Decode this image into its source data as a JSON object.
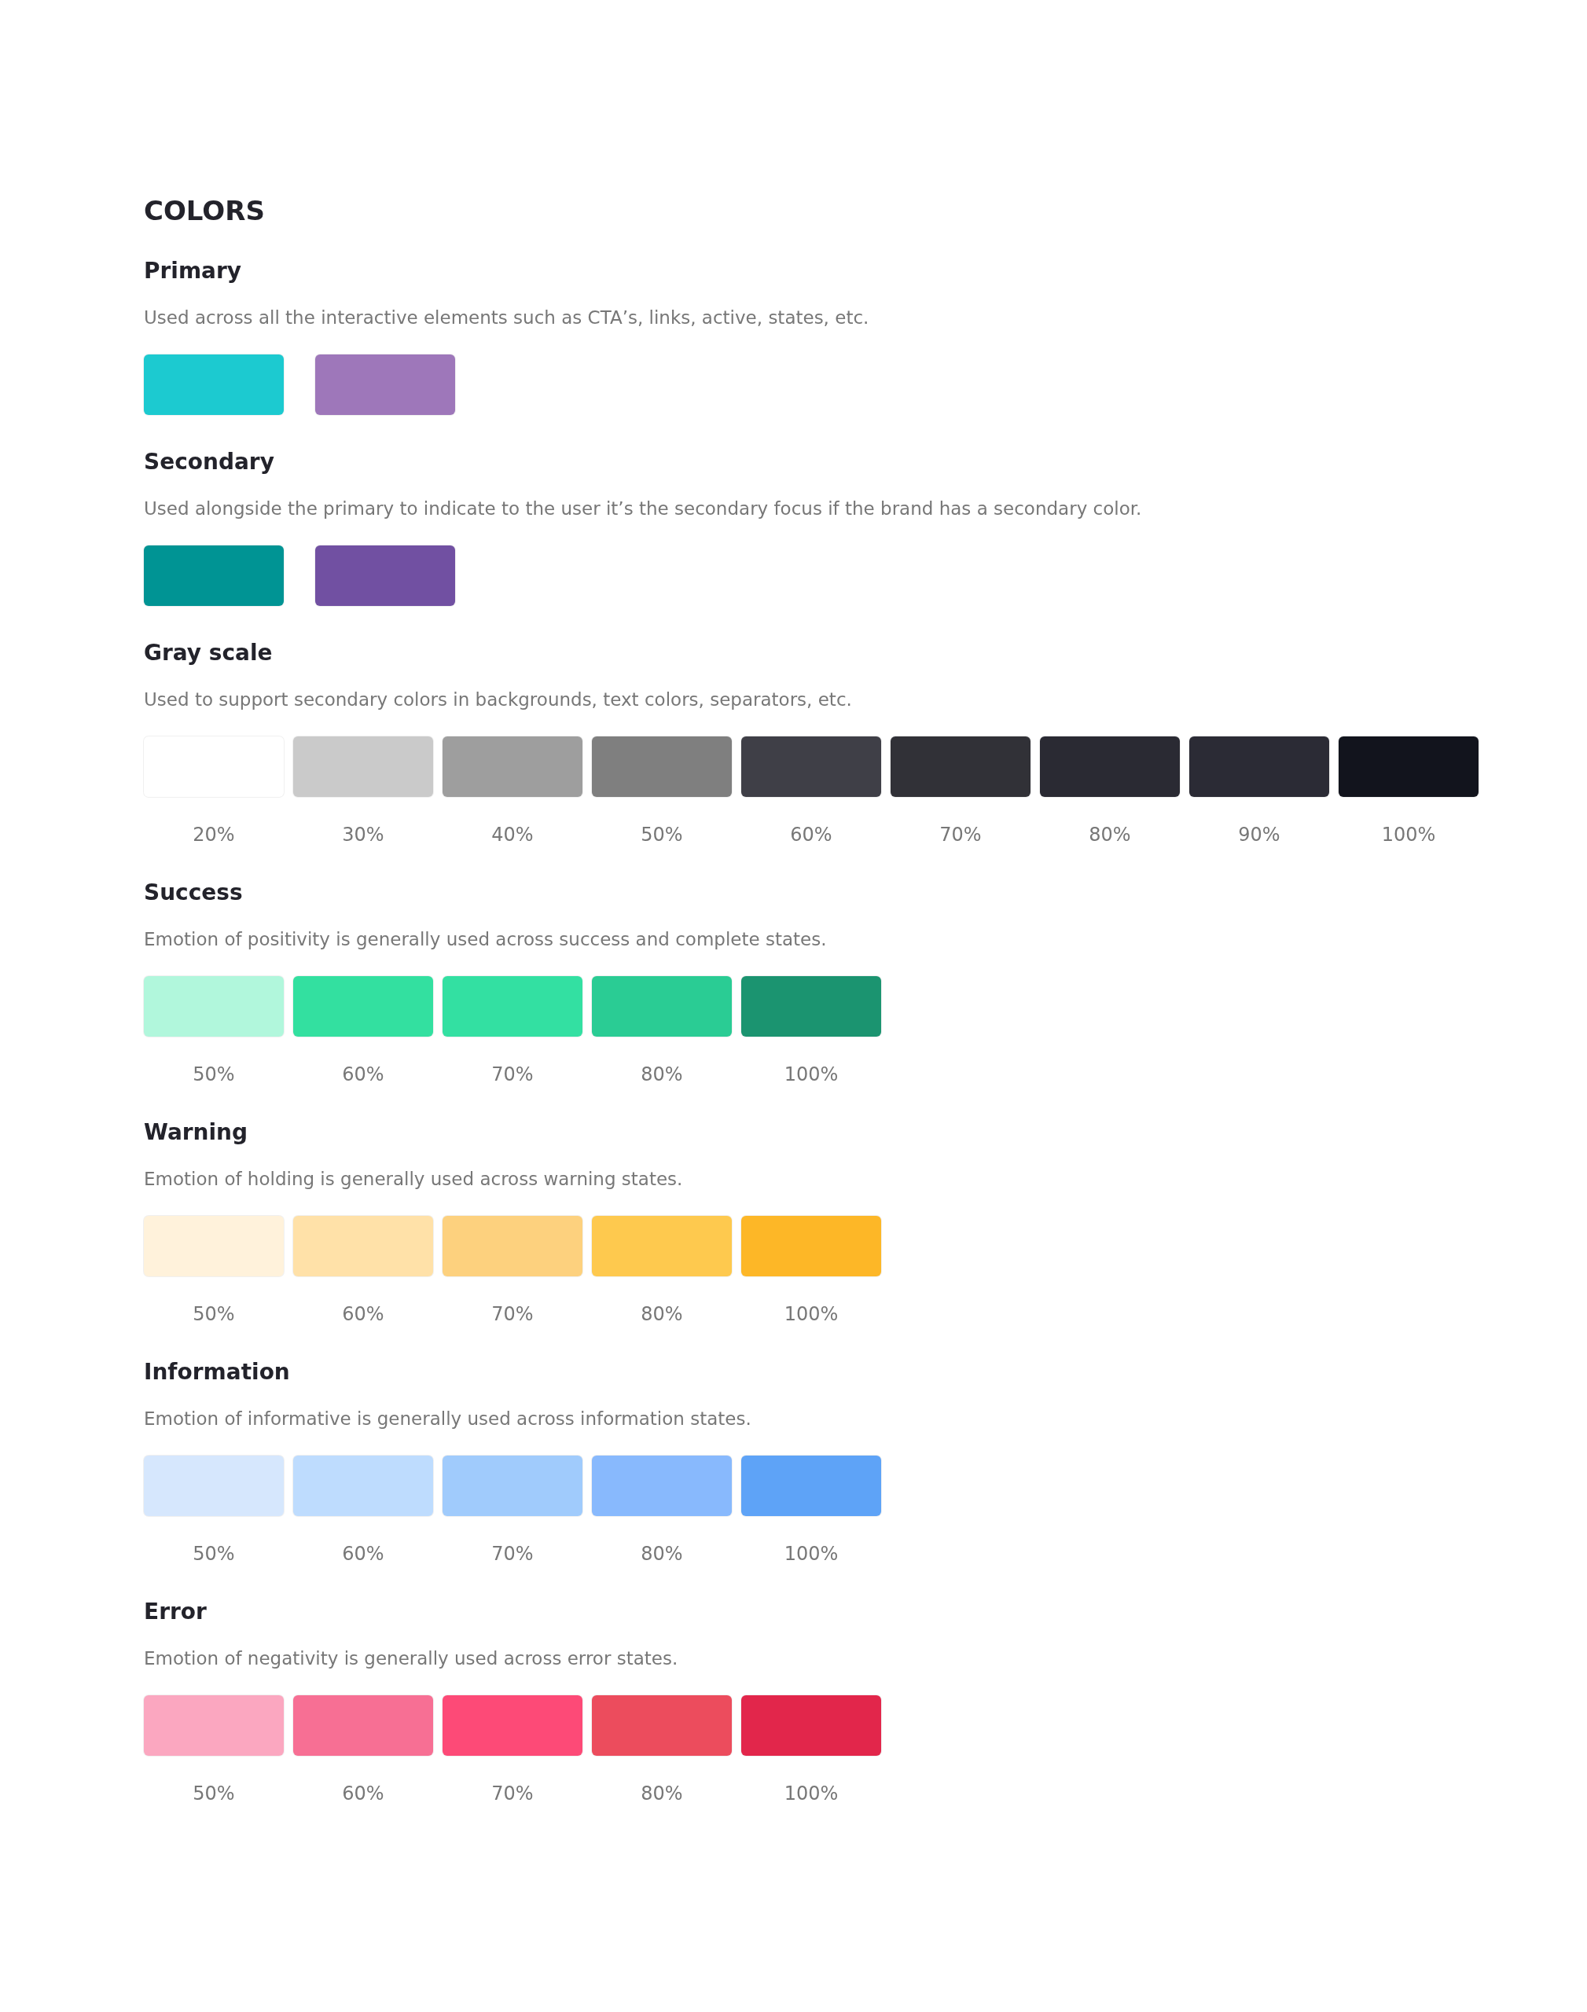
{
  "title": "COLORS",
  "sections": [
    {
      "title": "Primary",
      "description": "Used across all the interactive elements such as CTA’s, links, active, states, etc.",
      "swatches": [
        {
          "color": "#1ccad0"
        },
        {
          "color": "#9e77ba"
        }
      ]
    },
    {
      "title": "Secondary",
      "description": "Used alongside the primary to indicate to the user it’s the secondary focus if the brand has a secondary color.",
      "swatches": [
        {
          "color": "#009494"
        },
        {
          "color": "#7150a2"
        }
      ]
    },
    {
      "title": "Gray scale",
      "description": "Used to support secondary colors in backgrounds, text colors, separators, etc.",
      "swatches": [
        {
          "color": "#ffffff",
          "label": "20%"
        },
        {
          "color": "#cacaca",
          "label": "30%"
        },
        {
          "color": "#9e9e9e",
          "label": "40%"
        },
        {
          "color": "#7f7f7f",
          "label": "50%"
        },
        {
          "color": "#3f3f47",
          "label": "60%"
        },
        {
          "color": "#313137",
          "label": "70%"
        },
        {
          "color": "#2a2a33",
          "label": "80%"
        },
        {
          "color": "#2b2b35",
          "label": "90%"
        },
        {
          "color": "#12141d",
          "label": "100%"
        }
      ]
    },
    {
      "title": "Success",
      "description": "Emotion of positivity is generally used across success and complete states.",
      "swatches": [
        {
          "color": "#b1f7dc",
          "label": "50%"
        },
        {
          "color": "#33e0a0",
          "label": "60%"
        },
        {
          "color": "#33e0a2",
          "label": "70%"
        },
        {
          "color": "#2acc94",
          "label": "80%"
        },
        {
          "color": "#1b9470",
          "label": "100%"
        }
      ]
    },
    {
      "title": "Warning",
      "description": "Emotion of holding is generally used across warning states.",
      "swatches": [
        {
          "color": "#fff2db",
          "label": "50%"
        },
        {
          "color": "#ffe1a8",
          "label": "60%"
        },
        {
          "color": "#fdd17e",
          "label": "70%"
        },
        {
          "color": "#fec94e",
          "label": "80%"
        },
        {
          "color": "#fdb727",
          "label": "100%"
        }
      ]
    },
    {
      "title": "Information",
      "description": "Emotion of informative is generally used across information states.",
      "swatches": [
        {
          "color": "#d6e7fd",
          "label": "50%"
        },
        {
          "color": "#bedcfe",
          "label": "60%"
        },
        {
          "color": "#a0cbfc",
          "label": "70%"
        },
        {
          "color": "#88b9fd",
          "label": "80%"
        },
        {
          "color": "#5ea3f7",
          "label": "100%"
        }
      ]
    },
    {
      "title": "Error",
      "description": "Emotion of negativity is generally used across error states.",
      "swatches": [
        {
          "color": "#fba7c0",
          "label": "50%"
        },
        {
          "color": "#f76f94",
          "label": "60%"
        },
        {
          "color": "#fd4a77",
          "label": "70%"
        },
        {
          "color": "#ec4c5d",
          "label": "80%"
        },
        {
          "color": "#e2264b",
          "label": "100%"
        }
      ]
    }
  ]
}
